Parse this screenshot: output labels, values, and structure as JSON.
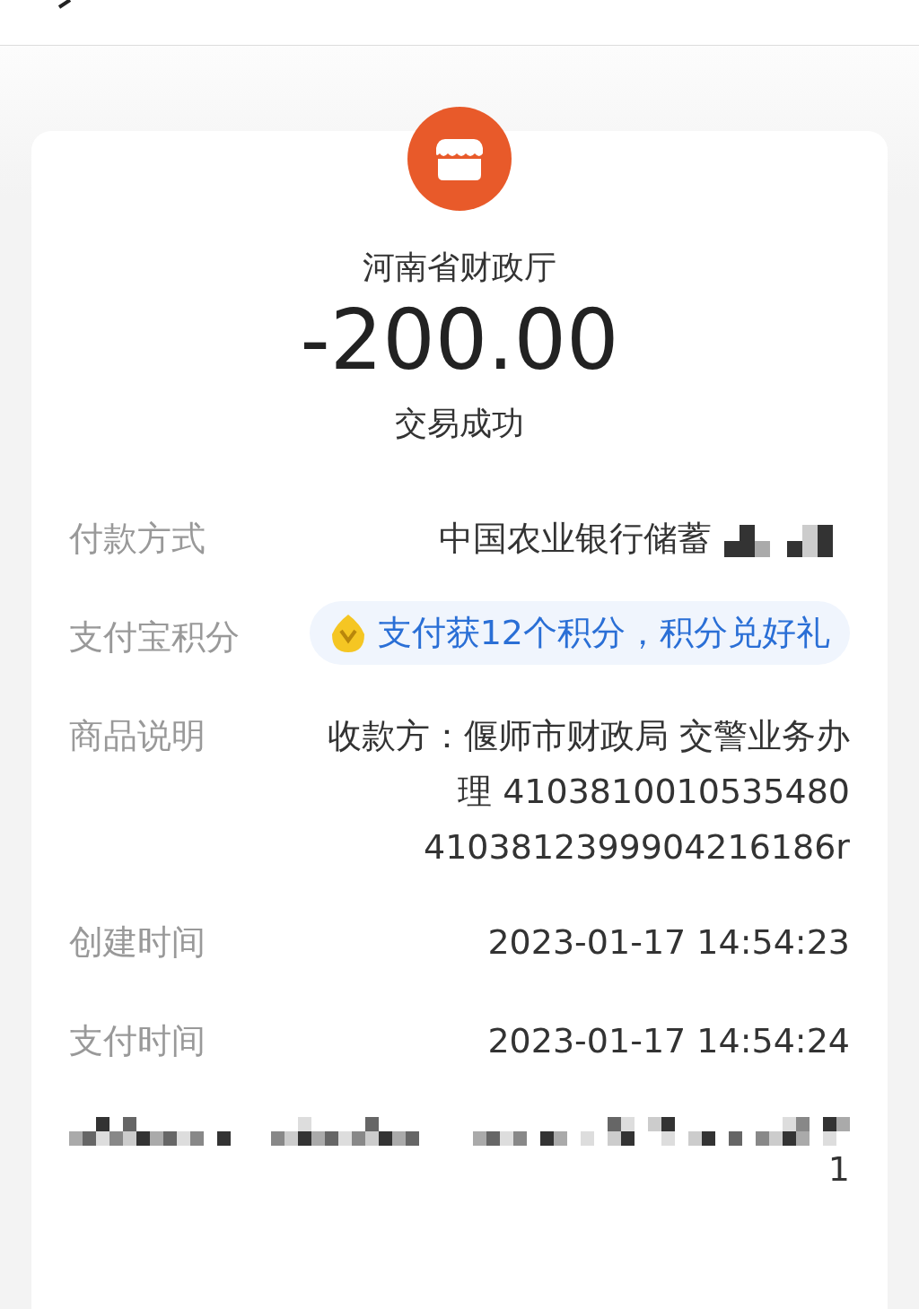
{
  "merchant": {
    "name": "河南省财政厅"
  },
  "amount": "-200.00",
  "status": "交易成功",
  "details": [
    {
      "kind": "masked",
      "label": "付款方式",
      "value": "中国农业银行储蓄"
    },
    {
      "kind": "promo",
      "label": "支付宝积分",
      "value": "支付获12个积分，积分兑好礼"
    },
    {
      "kind": "multiline",
      "label": "商品说明",
      "lines": [
        "收款方：偃师市财政局 交警业务办",
        "理 4103810010535480",
        "4103812399904216186r"
      ]
    },
    {
      "kind": "text",
      "label": "创建时间",
      "value": "2023-01-17 14:54:23"
    },
    {
      "kind": "text",
      "label": "支付时间",
      "value": "2023-01-17 14:54:24"
    }
  ],
  "masked_row": {
    "trailing": "1"
  }
}
